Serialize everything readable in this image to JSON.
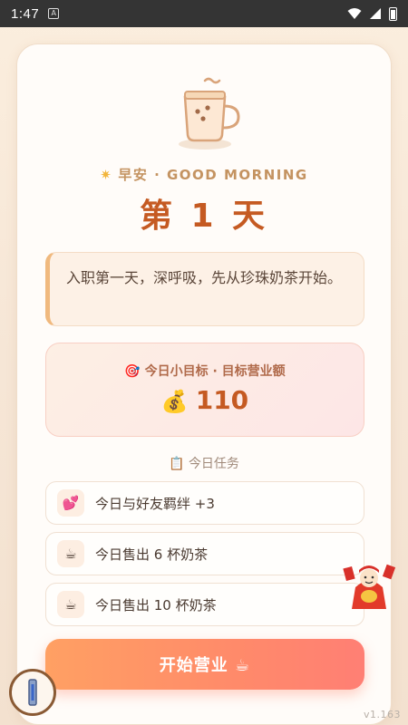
{
  "status_bar": {
    "time": "1:47"
  },
  "greeting": {
    "icon": "sun-icon",
    "text": "早安 · GOOD MORNING"
  },
  "day_title": "第 1 天",
  "quote": "入职第一天，深呼吸，先从珍珠奶茶开始。",
  "goal": {
    "label_icon": "🎯",
    "label": "今日小目标 · 目标营业额",
    "value_icon": "💰",
    "value": "110"
  },
  "tasks_header": {
    "icon": "📋",
    "label": "今日任务"
  },
  "tasks": [
    {
      "icon": "💕",
      "label": "今日与好友羁绊 +3"
    },
    {
      "icon": "☕",
      "label": "今日售出 6 杯奶茶"
    },
    {
      "icon": "☕",
      "label": "今日售出 10 杯奶茶"
    }
  ],
  "start_button": {
    "label": "开始营业 ☕"
  },
  "version": "v1.163",
  "colors": {
    "accent": "#c55a22",
    "button_start": "#ffa063",
    "button_end": "#ff7f74"
  }
}
